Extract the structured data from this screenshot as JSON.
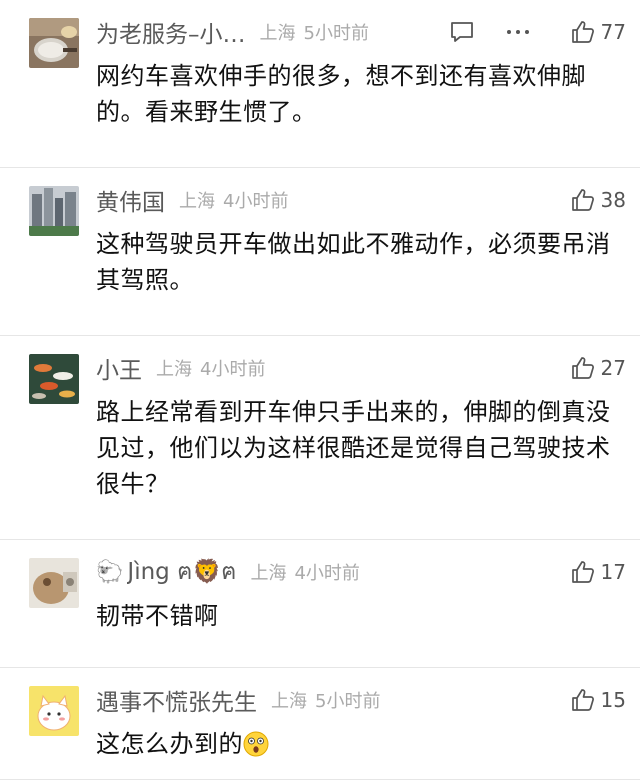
{
  "comments": [
    {
      "username": "为老服务–小…",
      "location": "上海",
      "time": "5小时前",
      "likes": "77",
      "text": "网约车喜欢伸手的很多，想不到还有喜欢伸脚的。看来野生惯了。",
      "avatar_icon": "cooking-pot-avatar",
      "has_reply_more": true
    },
    {
      "username": "黄伟国",
      "location": "上海",
      "time": "4小时前",
      "likes": "38",
      "text": "这种驾驶员开车做出如此不雅动作，必须要吊消其驾照。",
      "avatar_icon": "city-buildings-avatar"
    },
    {
      "username": "小王",
      "location": "上海",
      "time": "4小时前",
      "likes": "27",
      "text": "路上经常看到开车伸只手出来的，伸脚的倒真没见过，他们以为这样很酷还是觉得自己驾驶技术很牛？",
      "avatar_icon": "koi-fish-avatar"
    },
    {
      "username": "Jìng ฅ🦁ฅ",
      "location": "上海",
      "time": "4小时前",
      "likes": "17",
      "text": "韧带不错啊",
      "avatar_icon": "plush-toy-avatar"
    },
    {
      "username": "遇事不慌张先生",
      "location": "上海",
      "time": "5小时前",
      "likes": "15",
      "text": "这怎么办到的",
      "avatar_icon": "cartoon-cat-avatar",
      "text_emoji": "astonished-face-icon"
    }
  ]
}
